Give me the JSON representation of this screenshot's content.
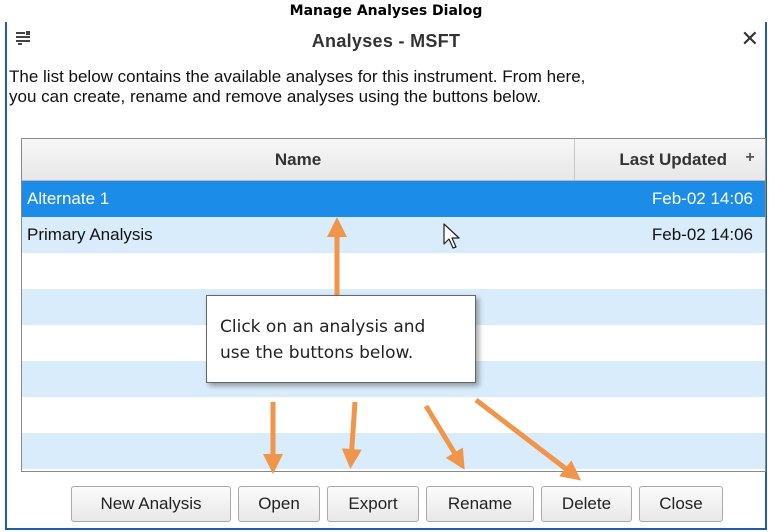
{
  "caption": "Manage Analyses Dialog",
  "dialog": {
    "title": "Analyses - MSFT",
    "close_glyph": "✕",
    "window_icon": "window-menu-icon",
    "description_lines": [
      "The list below contains the available analyses for this instrument.  From here,",
      "you can create, rename and remove analyses using the buttons below."
    ]
  },
  "table": {
    "columns": {
      "name": "Name",
      "last_updated": "Last Updated",
      "add": "+"
    },
    "rows": [
      {
        "name": "Alternate 1",
        "last_updated": "Feb-02 14:06",
        "selected": true
      },
      {
        "name": "Primary Analysis",
        "last_updated": "Feb-02 14:06",
        "selected": false
      }
    ]
  },
  "callout": {
    "lines": [
      "Click on an analysis and",
      "use the buttons below."
    ]
  },
  "buttons": {
    "new_analysis": "New Analysis",
    "open": "Open",
    "export": "Export",
    "rename": "Rename",
    "delete": "Delete",
    "close": "Close"
  },
  "colors": {
    "selected_row": "#1b8de8",
    "alt_row": "#d9ecfb",
    "arrow": "#f0954a",
    "dialog_border": "#1b5fa8"
  }
}
